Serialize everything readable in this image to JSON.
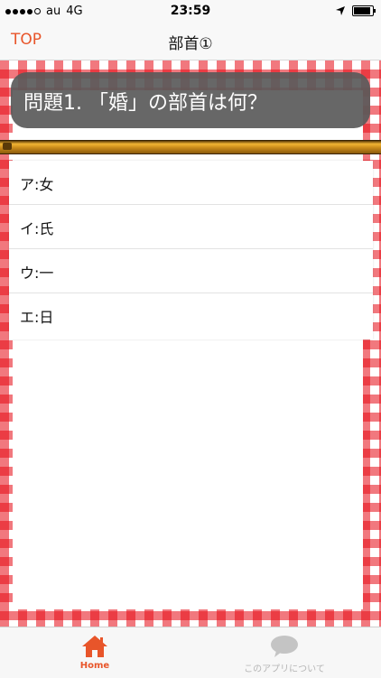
{
  "status_bar": {
    "carrier": "au",
    "network": "4G",
    "time": "23:59"
  },
  "nav": {
    "back_label": "TOP",
    "title": "部首①"
  },
  "question": {
    "text": "問題1. 「婚」の部首は何？"
  },
  "answers": [
    {
      "label": "ア:女"
    },
    {
      "label": "イ:氏"
    },
    {
      "label": "ウ:一"
    },
    {
      "label": "エ:日"
    }
  ],
  "tab_bar": {
    "home_label": "Home",
    "about_label": "このアプリについて"
  },
  "colors": {
    "accent": "#e8552a",
    "checker_red": "#e60a14",
    "bubble": "#5a5a5a"
  }
}
